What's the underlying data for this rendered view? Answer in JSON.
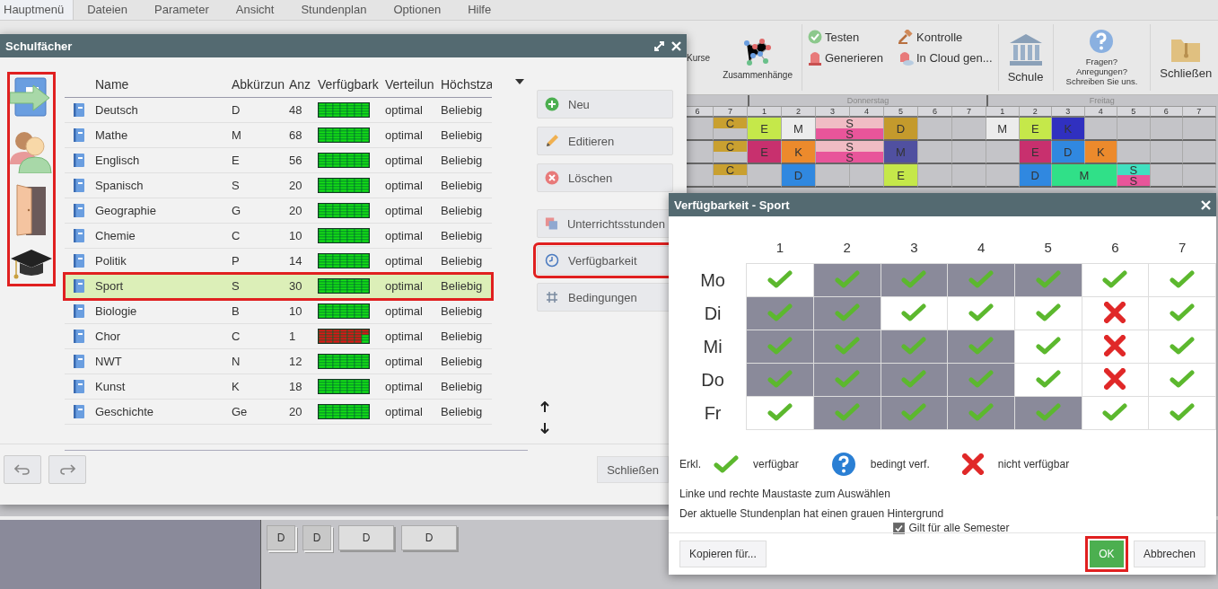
{
  "menu": [
    {
      "label": "Hauptmenü",
      "selected": true
    },
    {
      "label": "Dateien",
      "selected": false
    },
    {
      "label": "Parameter",
      "selected": false
    },
    {
      "label": "Ansicht",
      "selected": false
    },
    {
      "label": "Stundenplan",
      "selected": false
    },
    {
      "label": "Optionen",
      "selected": false
    },
    {
      "label": "Hilfe",
      "selected": false
    }
  ],
  "ribbon": {
    "groups": [
      {
        "kind": "large",
        "items": [
          "Kurse",
          "Zusammenhänge"
        ]
      },
      {
        "kind": "small",
        "items": [
          "Testen",
          "Kontrolle",
          "Generieren",
          "In Cloud gen..."
        ]
      },
      {
        "kind": "large",
        "items": [
          "Schule"
        ]
      },
      {
        "kind": "note",
        "items": [
          "Fragen?\nAnregungen?\nSchreiben Sie uns."
        ]
      },
      {
        "kind": "large",
        "items": [
          "Schließen"
        ]
      }
    ]
  },
  "timetable": {
    "days": [
      {
        "periods": [
          "6",
          "7"
        ]
      },
      {
        "name": "Donnerstag",
        "periods": [
          "1",
          "2",
          "3",
          "4",
          "5",
          "6",
          "7"
        ]
      },
      {
        "name": "Freitag",
        "periods": [
          "1",
          "2",
          "3",
          "4",
          "5",
          "6",
          "7"
        ]
      }
    ],
    "rows": [
      {
        "slots": [
          {
            "kind": "empty"
          },
          {
            "kind": "half",
            "lessons": [
              {
                "label": "C",
                "color": "#c9a030"
              }
            ]
          },
          {
            "kind": "lesson",
            "lessons": [
              {
                "label": "E",
                "color": "#c5e84a"
              }
            ]
          },
          {
            "kind": "lesson",
            "lessons": [
              {
                "label": "M",
                "color": "#ececec"
              }
            ]
          },
          {
            "kind": "lesson",
            "wide": true,
            "lessons": [
              {
                "label": "S",
                "color": "#f0bcc4"
              },
              {
                "label": "S",
                "color": "#e8559a"
              }
            ]
          },
          {
            "kind": "lesson",
            "lessons": [
              {
                "label": "D",
                "color": "#c49a2c"
              }
            ]
          },
          {
            "kind": "empty"
          },
          {
            "kind": "empty"
          },
          {
            "kind": "lesson",
            "lessons": [
              {
                "label": "M",
                "color": "#ececec"
              }
            ]
          },
          {
            "kind": "lesson",
            "lessons": [
              {
                "label": "E",
                "color": "#c5e84a"
              }
            ]
          },
          {
            "kind": "lesson",
            "lessons": [
              {
                "label": "K",
                "color": "#3030c0"
              }
            ]
          },
          {
            "kind": "empty"
          },
          {
            "kind": "empty"
          },
          {
            "kind": "empty"
          },
          {
            "kind": "empty"
          }
        ]
      },
      {
        "slots": [
          {
            "kind": "empty"
          },
          {
            "kind": "half",
            "lessons": [
              {
                "label": "C",
                "color": "#c9a030"
              }
            ]
          },
          {
            "kind": "lesson",
            "lessons": [
              {
                "label": "E",
                "color": "#c8306e"
              }
            ]
          },
          {
            "kind": "lesson",
            "lessons": [
              {
                "label": "K",
                "color": "#ec8a2c"
              }
            ]
          },
          {
            "kind": "lesson",
            "wide": true,
            "lessons": [
              {
                "label": "S",
                "color": "#f0bcc4"
              },
              {
                "label": "S",
                "color": "#e8559a"
              }
            ]
          },
          {
            "kind": "lesson",
            "lessons": [
              {
                "label": "M",
                "color": "#5050a0"
              }
            ]
          },
          {
            "kind": "empty"
          },
          {
            "kind": "empty"
          },
          {
            "kind": "empty"
          },
          {
            "kind": "lesson",
            "lessons": [
              {
                "label": "E",
                "color": "#c8306e"
              }
            ]
          },
          {
            "kind": "lesson",
            "lessons": [
              {
                "label": "D",
                "color": "#3088e0"
              }
            ]
          },
          {
            "kind": "lesson",
            "lessons": [
              {
                "label": "K",
                "color": "#ec8a2c"
              }
            ]
          },
          {
            "kind": "empty"
          },
          {
            "kind": "empty"
          },
          {
            "kind": "empty"
          }
        ]
      },
      {
        "slots": [
          {
            "kind": "empty"
          },
          {
            "kind": "half",
            "lessons": [
              {
                "label": "C",
                "color": "#c9a030"
              }
            ]
          },
          {
            "kind": "empty"
          },
          {
            "kind": "lesson",
            "lessons": [
              {
                "label": "D",
                "color": "#3088e0"
              }
            ]
          },
          {
            "kind": "empty"
          },
          {
            "kind": "empty"
          },
          {
            "kind": "lesson",
            "lessons": [
              {
                "label": "E",
                "color": "#c5e84a"
              }
            ]
          },
          {
            "kind": "empty"
          },
          {
            "kind": "empty"
          },
          {
            "kind": "empty"
          },
          {
            "kind": "lesson",
            "lessons": [
              {
                "label": "D",
                "color": "#3088e0"
              }
            ]
          },
          {
            "kind": "lesson",
            "wide": true,
            "lessons": [
              {
                "label": "M",
                "color": "#30e088"
              }
            ]
          },
          {
            "kind": "lesson",
            "lessons": [
              {
                "label": "S",
                "color": "#40e0c0"
              },
              {
                "label": "S",
                "color": "#e8559a"
              }
            ]
          },
          {
            "kind": "empty"
          },
          {
            "kind": "empty"
          }
        ]
      }
    ]
  },
  "pool": [
    {
      "label": "D",
      "stacked": true
    },
    {
      "label": "D",
      "stacked": true
    },
    {
      "label": "D",
      "stacked": false
    },
    {
      "label": "D",
      "stacked": false
    }
  ],
  "subjects_dialog": {
    "title": "Schulfächer",
    "sidebar": {
      "highlighted": true
    },
    "columns": [
      "Name",
      "Abkürzun",
      "Anz",
      "Verfügbark",
      "Verteilun",
      "Höchstza"
    ],
    "rows": [
      {
        "name": "Deutsch",
        "abbr": "D",
        "count": "48",
        "available": true,
        "distribution": "optimal",
        "max": "Beliebig",
        "selected": false,
        "highlighted": false
      },
      {
        "name": "Mathe",
        "abbr": "M",
        "count": "68",
        "available": true,
        "distribution": "optimal",
        "max": "Beliebig",
        "selected": false,
        "highlighted": false
      },
      {
        "name": "Englisch",
        "abbr": "E",
        "count": "56",
        "available": true,
        "distribution": "optimal",
        "max": "Beliebig",
        "selected": false,
        "highlighted": false
      },
      {
        "name": "Spanisch",
        "abbr": "S",
        "count": "20",
        "available": true,
        "distribution": "optimal",
        "max": "Beliebig",
        "selected": false,
        "highlighted": false
      },
      {
        "name": "Geographie",
        "abbr": "G",
        "count": "20",
        "available": true,
        "distribution": "optimal",
        "max": "Beliebig",
        "selected": false,
        "highlighted": false
      },
      {
        "name": "Chemie",
        "abbr": "C",
        "count": "10",
        "available": true,
        "distribution": "optimal",
        "max": "Beliebig",
        "selected": false,
        "highlighted": false
      },
      {
        "name": "Politik",
        "abbr": "P",
        "count": "14",
        "available": true,
        "distribution": "optimal",
        "max": "Beliebig",
        "selected": false,
        "highlighted": false
      },
      {
        "name": "Sport",
        "abbr": "S",
        "count": "30",
        "available": true,
        "distribution": "optimal",
        "max": "Beliebig",
        "selected": true,
        "highlighted": true
      },
      {
        "name": "Biologie",
        "abbr": "B",
        "count": "10",
        "available": true,
        "distribution": "optimal",
        "max": "Beliebig",
        "selected": false,
        "highlighted": false
      },
      {
        "name": "Chor",
        "abbr": "C",
        "count": "1",
        "available": false,
        "distribution": "optimal",
        "max": "Beliebig",
        "selected": false,
        "highlighted": false
      },
      {
        "name": "NWT",
        "abbr": "N",
        "count": "12",
        "available": true,
        "distribution": "optimal",
        "max": "Beliebig",
        "selected": false,
        "highlighted": false
      },
      {
        "name": "Kunst",
        "abbr": "K",
        "count": "18",
        "available": true,
        "distribution": "optimal",
        "max": "Beliebig",
        "selected": false,
        "highlighted": false
      },
      {
        "name": "Geschichte",
        "abbr": "Ge",
        "count": "20",
        "available": true,
        "distribution": "optimal",
        "max": "Beliebig",
        "selected": false,
        "highlighted": false
      }
    ],
    "button_groups": [
      {
        "buttons": [
          {
            "label": "Neu",
            "highlighted": false
          },
          {
            "label": "Editieren",
            "highlighted": false
          },
          {
            "label": "Löschen",
            "highlighted": false
          }
        ]
      },
      {
        "buttons": [
          {
            "label": "Unterrichtsstunden",
            "highlighted": false
          },
          {
            "label": "Verfügbarkeit",
            "highlighted": true
          },
          {
            "label": "Bedingungen",
            "highlighted": false
          }
        ]
      }
    ],
    "close_label": "Schließen"
  },
  "availability_dialog": {
    "title": "Verfügbarkeit - Sport",
    "periods": [
      "1",
      "2",
      "3",
      "4",
      "5",
      "6",
      "7"
    ],
    "grid": [
      {
        "day": "Mo",
        "cells": [
          {
            "available": true,
            "current": false
          },
          {
            "available": true,
            "current": true
          },
          {
            "available": true,
            "current": true
          },
          {
            "available": true,
            "current": true
          },
          {
            "available": true,
            "current": true
          },
          {
            "available": true,
            "current": false
          },
          {
            "available": true,
            "current": false
          }
        ]
      },
      {
        "day": "Di",
        "cells": [
          {
            "available": true,
            "current": true
          },
          {
            "available": true,
            "current": true
          },
          {
            "available": true,
            "current": false
          },
          {
            "available": true,
            "current": false
          },
          {
            "available": true,
            "current": false
          },
          {
            "available": false,
            "current": false
          },
          {
            "available": true,
            "current": false
          }
        ]
      },
      {
        "day": "Mi",
        "cells": [
          {
            "available": true,
            "current": true
          },
          {
            "available": true,
            "current": true
          },
          {
            "available": true,
            "current": true
          },
          {
            "available": true,
            "current": true
          },
          {
            "available": true,
            "current": false
          },
          {
            "available": false,
            "current": false
          },
          {
            "available": true,
            "current": false
          }
        ]
      },
      {
        "day": "Do",
        "cells": [
          {
            "available": true,
            "current": true
          },
          {
            "available": true,
            "current": true
          },
          {
            "available": true,
            "current": true
          },
          {
            "available": true,
            "current": true
          },
          {
            "available": true,
            "current": false
          },
          {
            "available": false,
            "current": false
          },
          {
            "available": true,
            "current": false
          }
        ]
      },
      {
        "day": "Fr",
        "cells": [
          {
            "available": true,
            "current": false
          },
          {
            "available": true,
            "current": true
          },
          {
            "available": true,
            "current": true
          },
          {
            "available": true,
            "current": true
          },
          {
            "available": true,
            "current": true
          },
          {
            "available": true,
            "current": false
          },
          {
            "available": true,
            "current": false
          }
        ]
      }
    ],
    "legend_title": "Erkl.",
    "legend": [
      {
        "kind": "yes",
        "label": "verfügbar"
      },
      {
        "kind": "maybe",
        "label": "bedingt verf."
      },
      {
        "kind": "no",
        "label": "nicht verfügbar"
      }
    ],
    "hints": [
      "Linke und rechte Maustaste zum Auswählen",
      "Der aktuelle Stundenplan hat einen grauen Hintergrund"
    ],
    "all_semesters": {
      "label": "Gilt für alle Semester",
      "checked": true
    },
    "copy_label": "Kopieren für...",
    "ok": {
      "label": "OK",
      "highlighted": true
    },
    "cancel_label": "Abbrechen"
  }
}
